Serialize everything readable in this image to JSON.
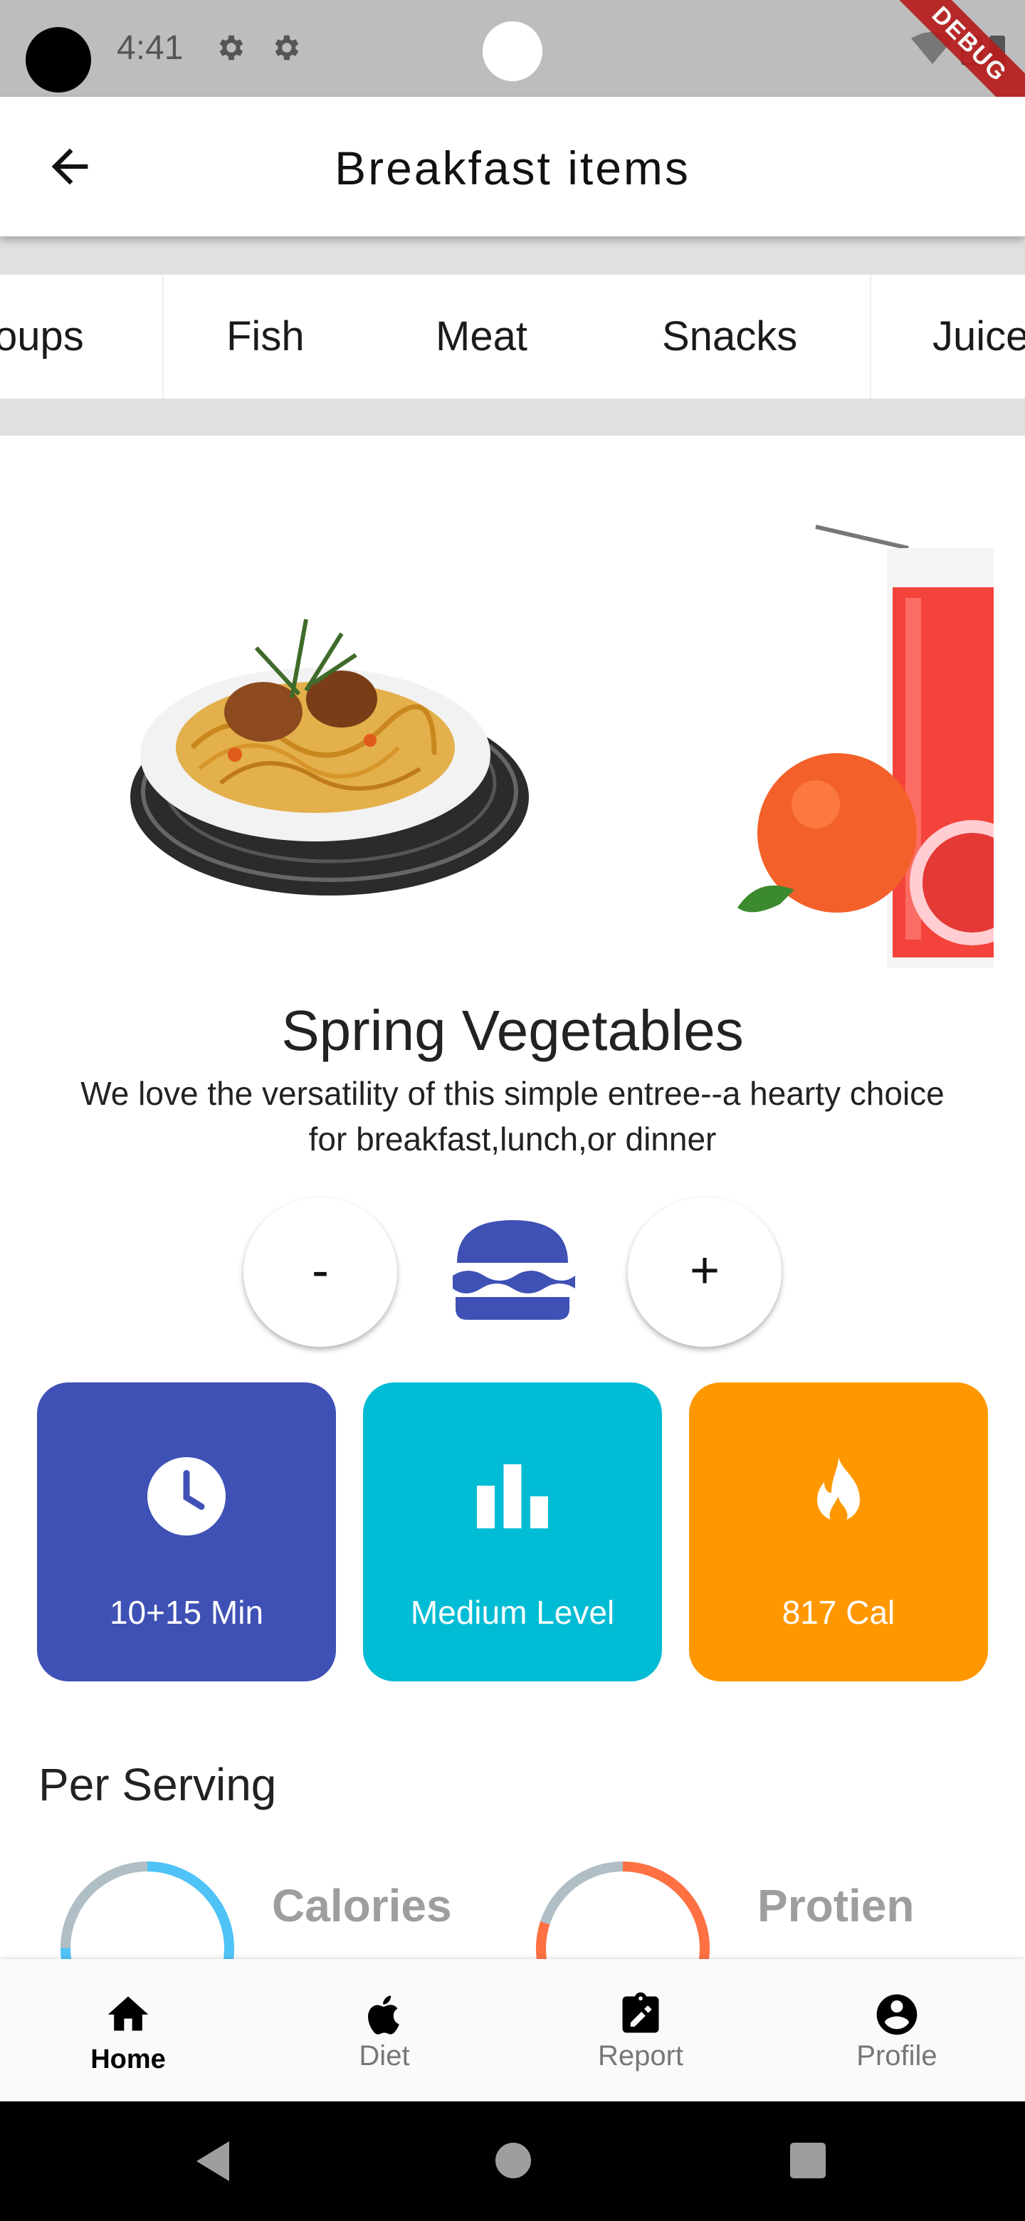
{
  "status_bar": {
    "time": "4:41",
    "debug_label": "DEBUG"
  },
  "app_bar": {
    "title": "Breakfast items"
  },
  "tabs": [
    "oups",
    "Fish",
    "Meat",
    "Snacks",
    "Juice"
  ],
  "food": {
    "title": "Spring Vegetables",
    "description": "We love the versatility of this simple entree--a hearty choice for breakfast,lunch,or dinner"
  },
  "quantity": {
    "minus_label": "-",
    "plus_label": "+"
  },
  "stats": [
    {
      "label": "10+15 Min",
      "icon": "clock-icon",
      "color": "#3f51b5"
    },
    {
      "label": "Medium Level",
      "icon": "bar-chart-icon",
      "color": "#00bcd4"
    },
    {
      "label": "817 Cal",
      "icon": "fire-icon",
      "color": "#ff9800"
    }
  ],
  "per_serving": {
    "title": "Per Serving",
    "nutrients": [
      {
        "label": "Calories",
        "color": "#4fc3f7",
        "track": "#b0bec5",
        "progress": 0.75
      },
      {
        "label": "Protien",
        "color": "#ff7043",
        "track": "#b0bec5",
        "progress": 0.8
      }
    ]
  },
  "bottom_nav": [
    {
      "label": "Home",
      "icon": "home-icon",
      "active": true
    },
    {
      "label": "Diet",
      "icon": "apple-icon",
      "active": false
    },
    {
      "label": "Report",
      "icon": "clipboard-edit-icon",
      "active": false
    },
    {
      "label": "Profile",
      "icon": "account-circle-icon",
      "active": false
    }
  ]
}
